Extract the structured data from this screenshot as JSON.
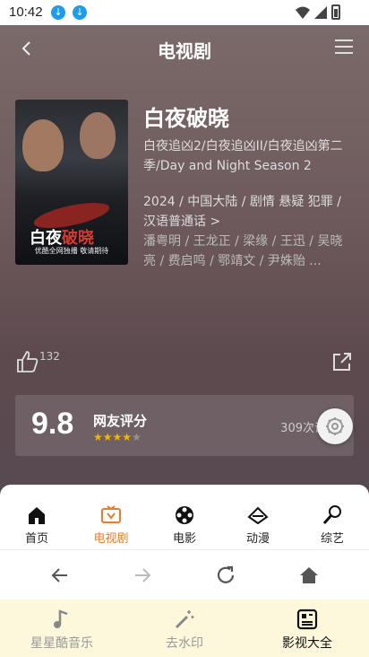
{
  "status": {
    "time": "10:42"
  },
  "header": {
    "title": "电视剧"
  },
  "show": {
    "title": "白夜破晓",
    "alias": "白夜追凶2/白夜追凶II/白夜追凶第二季/Day and Night Season 2",
    "meta": "2024 / 中国大陆 /  剧情 悬疑 犯罪 / 汉语普通话 >",
    "cast": "潘粤明 / 王龙正 / 梁缘 / 王迅 / 吴晓亮 / 费启鸣 / 鄂靖文 / 尹姝贻 ...",
    "poster": {
      "title_a": "白夜",
      "title_b": "破晓",
      "footer": "优酷全网独播 敬请期待"
    },
    "likes": "132"
  },
  "rating": {
    "score": "9.8",
    "label": "网友评分",
    "stars_filled": 4,
    "stars_total": 5,
    "count": "309次评分"
  },
  "tabs": [
    {
      "label": "首页",
      "icon": "home-icon"
    },
    {
      "label": "电视剧",
      "icon": "tv-icon",
      "active": true
    },
    {
      "label": "电影",
      "icon": "film-reel-icon"
    },
    {
      "label": "动漫",
      "icon": "anime-icon"
    },
    {
      "label": "综艺",
      "icon": "microphone-icon"
    }
  ],
  "apps": [
    {
      "label": "星星酷音乐",
      "icon": "music-note-icon"
    },
    {
      "label": "去水印",
      "icon": "magic-wand-icon"
    },
    {
      "label": "影视大全",
      "icon": "grid-icon",
      "active": true
    }
  ],
  "colors": {
    "accent": "#f07a2a",
    "star": "#f5b400",
    "appbar_bg": "#fdf7dc"
  }
}
